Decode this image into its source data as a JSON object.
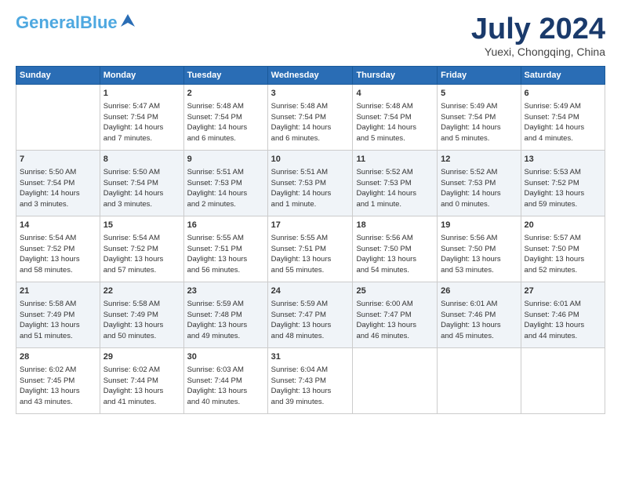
{
  "logo": {
    "line1": "General",
    "line2": "Blue",
    "bird": "▲"
  },
  "title": "July 2024",
  "subtitle": "Yuexi, Chongqing, China",
  "headers": [
    "Sunday",
    "Monday",
    "Tuesday",
    "Wednesday",
    "Thursday",
    "Friday",
    "Saturday"
  ],
  "weeks": [
    [
      {
        "day": "",
        "lines": []
      },
      {
        "day": "1",
        "lines": [
          "Sunrise: 5:47 AM",
          "Sunset: 7:54 PM",
          "Daylight: 14 hours",
          "and 7 minutes."
        ]
      },
      {
        "day": "2",
        "lines": [
          "Sunrise: 5:48 AM",
          "Sunset: 7:54 PM",
          "Daylight: 14 hours",
          "and 6 minutes."
        ]
      },
      {
        "day": "3",
        "lines": [
          "Sunrise: 5:48 AM",
          "Sunset: 7:54 PM",
          "Daylight: 14 hours",
          "and 6 minutes."
        ]
      },
      {
        "day": "4",
        "lines": [
          "Sunrise: 5:48 AM",
          "Sunset: 7:54 PM",
          "Daylight: 14 hours",
          "and 5 minutes."
        ]
      },
      {
        "day": "5",
        "lines": [
          "Sunrise: 5:49 AM",
          "Sunset: 7:54 PM",
          "Daylight: 14 hours",
          "and 5 minutes."
        ]
      },
      {
        "day": "6",
        "lines": [
          "Sunrise: 5:49 AM",
          "Sunset: 7:54 PM",
          "Daylight: 14 hours",
          "and 4 minutes."
        ]
      }
    ],
    [
      {
        "day": "7",
        "lines": [
          "Sunrise: 5:50 AM",
          "Sunset: 7:54 PM",
          "Daylight: 14 hours",
          "and 3 minutes."
        ]
      },
      {
        "day": "8",
        "lines": [
          "Sunrise: 5:50 AM",
          "Sunset: 7:54 PM",
          "Daylight: 14 hours",
          "and 3 minutes."
        ]
      },
      {
        "day": "9",
        "lines": [
          "Sunrise: 5:51 AM",
          "Sunset: 7:53 PM",
          "Daylight: 14 hours",
          "and 2 minutes."
        ]
      },
      {
        "day": "10",
        "lines": [
          "Sunrise: 5:51 AM",
          "Sunset: 7:53 PM",
          "Daylight: 14 hours",
          "and 1 minute."
        ]
      },
      {
        "day": "11",
        "lines": [
          "Sunrise: 5:52 AM",
          "Sunset: 7:53 PM",
          "Daylight: 14 hours",
          "and 1 minute."
        ]
      },
      {
        "day": "12",
        "lines": [
          "Sunrise: 5:52 AM",
          "Sunset: 7:53 PM",
          "Daylight: 14 hours",
          "and 0 minutes."
        ]
      },
      {
        "day": "13",
        "lines": [
          "Sunrise: 5:53 AM",
          "Sunset: 7:52 PM",
          "Daylight: 13 hours",
          "and 59 minutes."
        ]
      }
    ],
    [
      {
        "day": "14",
        "lines": [
          "Sunrise: 5:54 AM",
          "Sunset: 7:52 PM",
          "Daylight: 13 hours",
          "and 58 minutes."
        ]
      },
      {
        "day": "15",
        "lines": [
          "Sunrise: 5:54 AM",
          "Sunset: 7:52 PM",
          "Daylight: 13 hours",
          "and 57 minutes."
        ]
      },
      {
        "day": "16",
        "lines": [
          "Sunrise: 5:55 AM",
          "Sunset: 7:51 PM",
          "Daylight: 13 hours",
          "and 56 minutes."
        ]
      },
      {
        "day": "17",
        "lines": [
          "Sunrise: 5:55 AM",
          "Sunset: 7:51 PM",
          "Daylight: 13 hours",
          "and 55 minutes."
        ]
      },
      {
        "day": "18",
        "lines": [
          "Sunrise: 5:56 AM",
          "Sunset: 7:50 PM",
          "Daylight: 13 hours",
          "and 54 minutes."
        ]
      },
      {
        "day": "19",
        "lines": [
          "Sunrise: 5:56 AM",
          "Sunset: 7:50 PM",
          "Daylight: 13 hours",
          "and 53 minutes."
        ]
      },
      {
        "day": "20",
        "lines": [
          "Sunrise: 5:57 AM",
          "Sunset: 7:50 PM",
          "Daylight: 13 hours",
          "and 52 minutes."
        ]
      }
    ],
    [
      {
        "day": "21",
        "lines": [
          "Sunrise: 5:58 AM",
          "Sunset: 7:49 PM",
          "Daylight: 13 hours",
          "and 51 minutes."
        ]
      },
      {
        "day": "22",
        "lines": [
          "Sunrise: 5:58 AM",
          "Sunset: 7:49 PM",
          "Daylight: 13 hours",
          "and 50 minutes."
        ]
      },
      {
        "day": "23",
        "lines": [
          "Sunrise: 5:59 AM",
          "Sunset: 7:48 PM",
          "Daylight: 13 hours",
          "and 49 minutes."
        ]
      },
      {
        "day": "24",
        "lines": [
          "Sunrise: 5:59 AM",
          "Sunset: 7:47 PM",
          "Daylight: 13 hours",
          "and 48 minutes."
        ]
      },
      {
        "day": "25",
        "lines": [
          "Sunrise: 6:00 AM",
          "Sunset: 7:47 PM",
          "Daylight: 13 hours",
          "and 46 minutes."
        ]
      },
      {
        "day": "26",
        "lines": [
          "Sunrise: 6:01 AM",
          "Sunset: 7:46 PM",
          "Daylight: 13 hours",
          "and 45 minutes."
        ]
      },
      {
        "day": "27",
        "lines": [
          "Sunrise: 6:01 AM",
          "Sunset: 7:46 PM",
          "Daylight: 13 hours",
          "and 44 minutes."
        ]
      }
    ],
    [
      {
        "day": "28",
        "lines": [
          "Sunrise: 6:02 AM",
          "Sunset: 7:45 PM",
          "Daylight: 13 hours",
          "and 43 minutes."
        ]
      },
      {
        "day": "29",
        "lines": [
          "Sunrise: 6:02 AM",
          "Sunset: 7:44 PM",
          "Daylight: 13 hours",
          "and 41 minutes."
        ]
      },
      {
        "day": "30",
        "lines": [
          "Sunrise: 6:03 AM",
          "Sunset: 7:44 PM",
          "Daylight: 13 hours",
          "and 40 minutes."
        ]
      },
      {
        "day": "31",
        "lines": [
          "Sunrise: 6:04 AM",
          "Sunset: 7:43 PM",
          "Daylight: 13 hours",
          "and 39 minutes."
        ]
      },
      {
        "day": "",
        "lines": []
      },
      {
        "day": "",
        "lines": []
      },
      {
        "day": "",
        "lines": []
      }
    ]
  ]
}
